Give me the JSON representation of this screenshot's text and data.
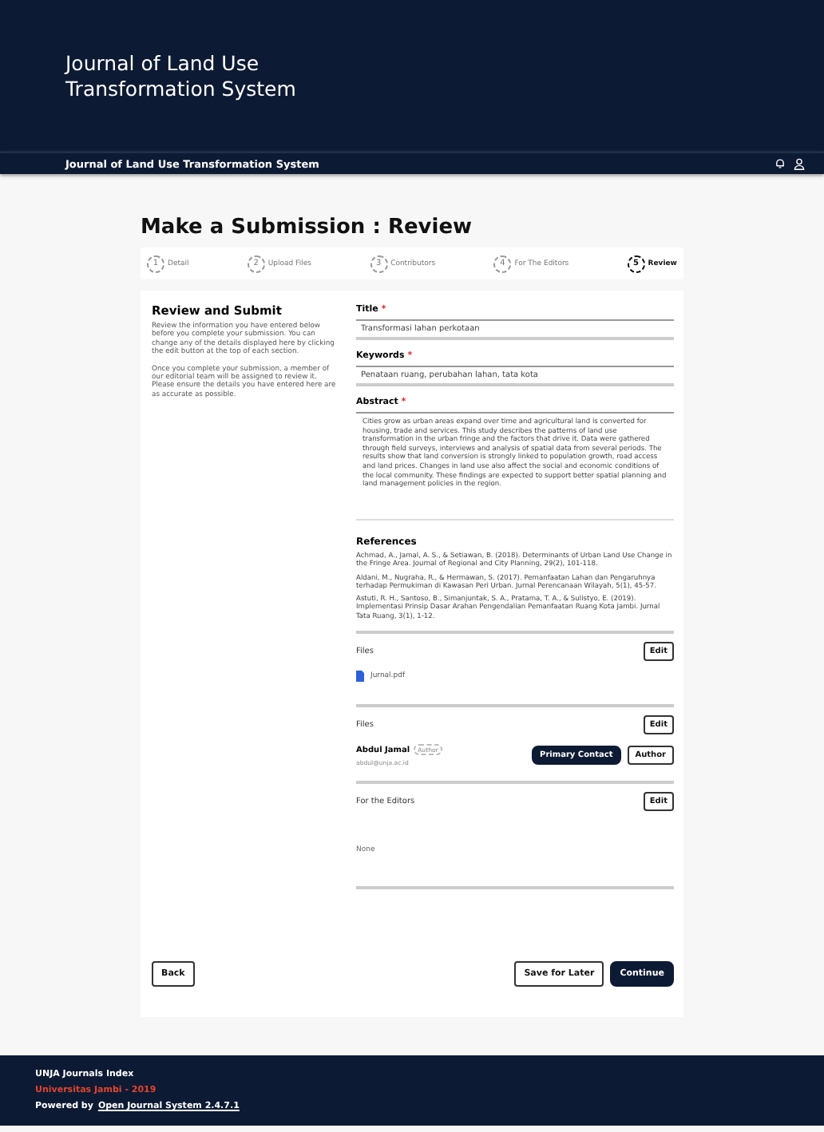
{
  "header": {
    "title": "Journal of Land Use Transformation System"
  },
  "navbar": {
    "title": "Journal of Land Use Transformation System"
  },
  "page_title": "Make a Submission : Review",
  "steps": [
    {
      "number": "1",
      "label": "Detail",
      "selected": false
    },
    {
      "number": "2",
      "label": "Upload Files",
      "selected": false
    },
    {
      "number": "3",
      "label": "Contributors",
      "selected": false
    },
    {
      "number": "4",
      "label": "For The Editors",
      "selected": false
    },
    {
      "number": "5",
      "label": "Review",
      "selected": true
    }
  ],
  "intro": {
    "heading": "Review and Submit",
    "paragraphs": [
      "Review the information you have entered below before you complete your submission. You can change any of the details displayed here by clicking the edit button at the top of each section.",
      "Once you complete your submission, a member of our editorial team will be assigned to review it. Please ensure the details you have entered here are as accurate as possible."
    ]
  },
  "details": {
    "required_mark": [
      "*",
      "*",
      "*"
    ],
    "title_label": "Title",
    "title_value": "Transformasi lahan perkotaan",
    "keywords_label": "Keywords",
    "keywords_value": "Penataan ruang, perubahan lahan, tata kota",
    "abstract_label": "Abstract",
    "abstract_value": "Cities grow as urban areas expand over time and agricultural land is converted for housing, trade and services. This study describes the patterns of land use transformation in the urban fringe and the factors that drive it. Data were gathered through field surveys, interviews and analysis of spatial data from several periods. The results show that land conversion is strongly linked to population growth, road access and land prices. Changes in land use also affect the social and economic conditions of the local community. These findings are expected to support better spatial planning and land management policies in the region.",
    "references_label": "References",
    "references": [
      "Achmad, A., Jamal, A. S., & Setiawan, B. (2018). Determinants of Urban Land Use Change in the Fringe Area. Journal of Regional and City Planning, 29(2), 101-118.",
      "Aldani, M., Nugraha, R., & Hermawan, S. (2017). Pemanfaatan Lahan dan Pengaruhnya terhadap Permukiman di Kawasan Peri Urban. Jurnal Perencanaan Wilayah, 5(1), 45-57.",
      "Astuti, R. H., Santoso, B., Simanjuntak, S. A., Pratama, T. A., & Sulistyo, E. (2019). Implementasi Prinsip Dasar Arahan Pengendalian Pemanfaatan Ruang Kota Jambi. Jurnal Tata Ruang, 3(1), 1-12."
    ]
  },
  "files": {
    "label": "Files",
    "edit": "Edit",
    "items": [
      "Jurnal.pdf"
    ]
  },
  "contributors": {
    "label": "Files",
    "edit": "Edit",
    "items": [
      {
        "name": "Abdul Jamal",
        "role_tag": "Author",
        "email": "abdul@unja.ac.id",
        "primary": "Primary Contact",
        "role": "Author"
      }
    ]
  },
  "editors": {
    "label": "For the Editors",
    "edit": "Edit",
    "value": "None"
  },
  "actions": {
    "back": "Back",
    "save": "Save for Later",
    "continue": "Continue"
  },
  "footer": {
    "line1": "UNJA Journals Index",
    "line2": "Universitas Jambi - 2019",
    "powered": "Powered by",
    "link": "Open Journal System 2.4.7.1"
  }
}
